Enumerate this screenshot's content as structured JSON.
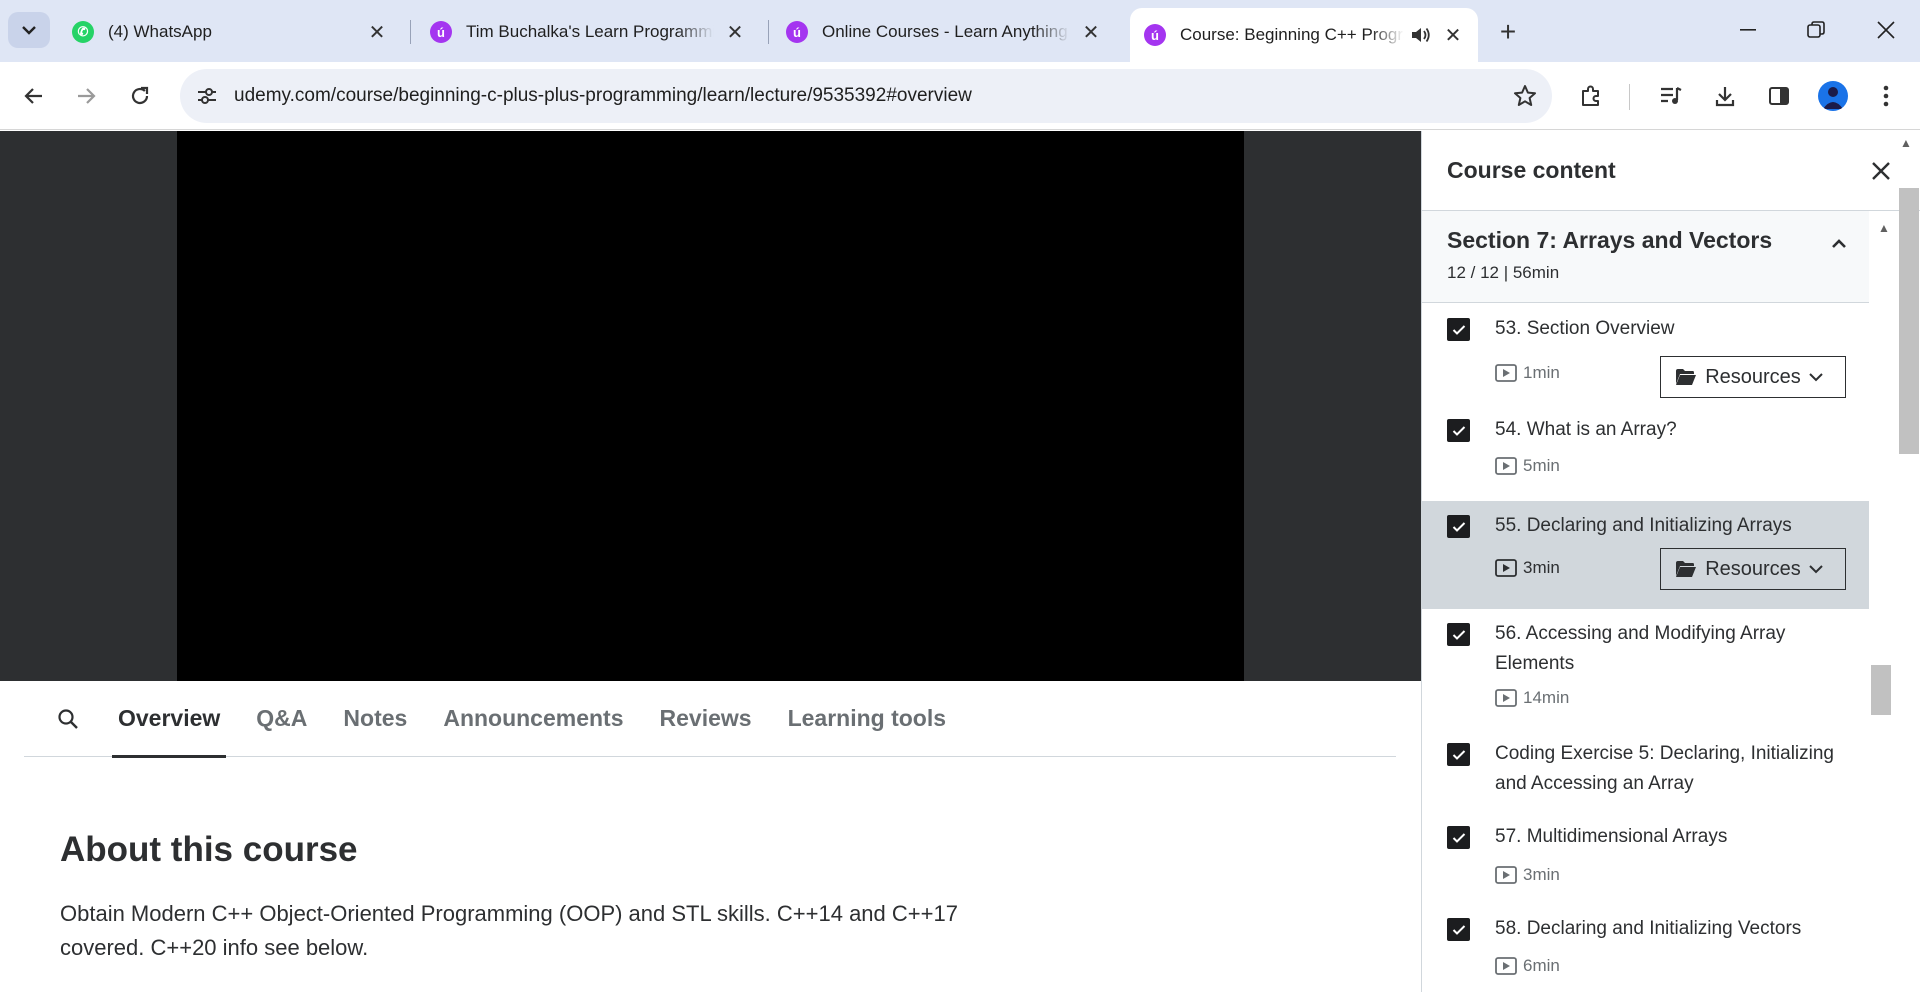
{
  "browser": {
    "tabs": [
      {
        "title": "(4) WhatsApp",
        "favicon": "whatsapp-icon"
      },
      {
        "title": "Tim Buchalka's Learn Programming",
        "favicon": "udemy-icon"
      },
      {
        "title": "Online Courses - Learn Anything",
        "favicon": "udemy-icon"
      },
      {
        "title": "Course: Beginning C++ Programming",
        "favicon": "udemy-icon",
        "active": true
      }
    ],
    "url": "udemy.com/course/beginning-c-plus-plus-programming/learn/lecture/9535392#overview"
  },
  "course_tabs": [
    "Overview",
    "Q&A",
    "Notes",
    "Announcements",
    "Reviews",
    "Learning tools"
  ],
  "about": {
    "title": "About this course",
    "text": "Obtain Modern C++ Object-Oriented Programming (OOP) and STL skills. C++14 and C++17 covered. C++20 info see below."
  },
  "sidebar": {
    "title": "Course content",
    "section": {
      "title": "Section 7: Arrays and Vectors",
      "meta": "12 / 12 | 56min"
    },
    "resources_label": "Resources",
    "lectures": [
      {
        "title": "53. Section Overview",
        "duration": "1min",
        "resources": true,
        "checked": true
      },
      {
        "title": "54. What is an Array?",
        "duration": "5min",
        "resources": false,
        "checked": true
      },
      {
        "title": "55. Declaring and Initializing Arrays",
        "duration": "3min",
        "resources": true,
        "checked": true,
        "current": true
      },
      {
        "title": "56. Accessing and Modifying Array Elements",
        "duration": "14min",
        "resources": false,
        "checked": true
      },
      {
        "title": "Coding Exercise 5: Declaring, Initializing and Accessing an Array",
        "duration": "",
        "resources": false,
        "checked": true
      },
      {
        "title": "57. Multidimensional Arrays",
        "duration": "3min",
        "resources": false,
        "checked": true
      },
      {
        "title": "58. Declaring and Initializing Vectors",
        "duration": "6min",
        "resources": false,
        "checked": true
      }
    ]
  }
}
